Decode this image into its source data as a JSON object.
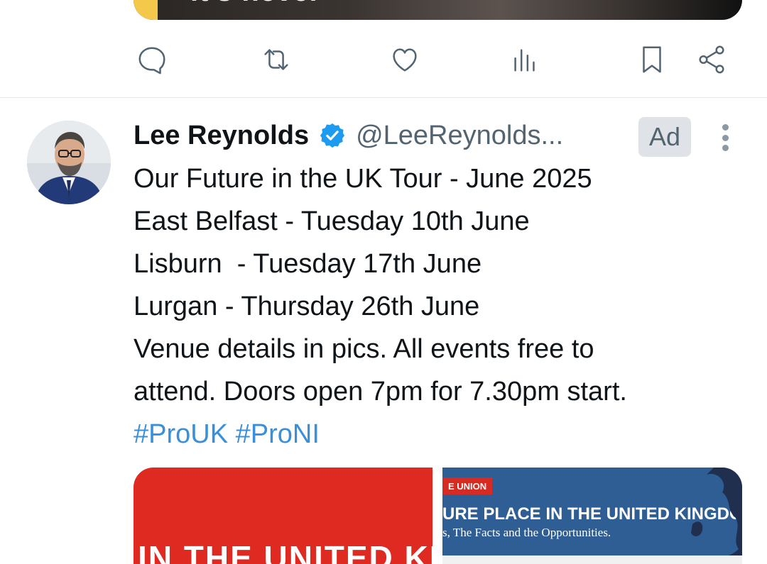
{
  "previous_tweet": {
    "media_overlay_text": "it's never"
  },
  "action_bar": {
    "icons": [
      "reply-icon",
      "retweet-icon",
      "like-icon",
      "views-icon",
      "bookmark-icon",
      "share-icon"
    ]
  },
  "tweet": {
    "display_name": "Lee Reynolds",
    "handle": "@LeeReynolds...",
    "ad_label": "Ad",
    "verified_color": "#1d9bf0",
    "lines": [
      "Our Future in the UK Tour - June 2025",
      "East Belfast - Tuesday 10th June",
      "Lisburn  - Tuesday 17th June",
      "Lurgan - Thursday 26th June",
      "Venue details in pics. All events free to",
      "attend. Doors open 7pm for 7.30pm start."
    ],
    "hashtags": [
      "#ProUK",
      "#ProNI"
    ],
    "media": {
      "left_text": "IN THE UNITED KINGD",
      "right_tag": "E UNION",
      "right_headline": "URE PLACE IN THE UNITED KINGDOM:",
      "right_subline": "s, The Facts and the Opportunities."
    }
  }
}
